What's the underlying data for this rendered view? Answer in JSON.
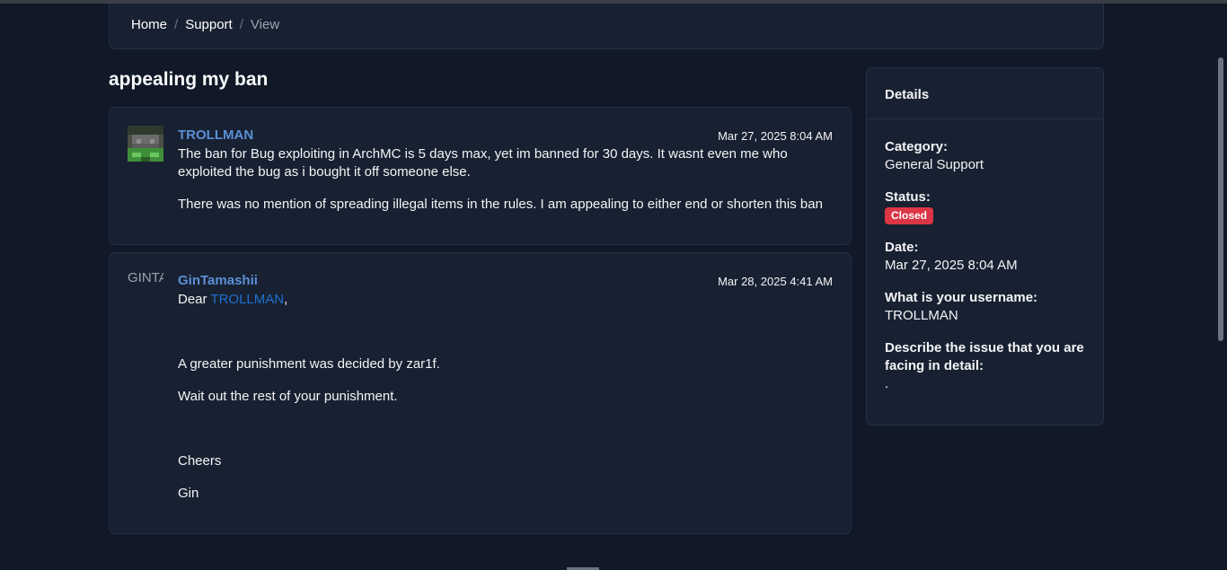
{
  "breadcrumb": {
    "items": [
      "Home",
      "Support"
    ],
    "separator": "/",
    "current": "View"
  },
  "page": {
    "title": "appealing my ban"
  },
  "posts": [
    {
      "author": "TROLLMAN",
      "date": "Mar 27, 2025 8:04 AM",
      "paragraphs": [
        "The ban for Bug exploiting in ArchMC is 5 days max, yet im banned for 30 days. It wasnt even me who exploited the bug as i bought it off someone else.",
        "There was no mention of spreading illegal items in the rules. I am appealing to either end or shorten this ban"
      ]
    },
    {
      "author": "GinTamashii",
      "avatar_alt": "GINTAMASHII",
      "date": "Mar 28, 2025 4:41 AM",
      "greeting_prefix": "Dear ",
      "greeting_mention": "TROLLMAN",
      "greeting_suffix": ",",
      "paragraphs": [
        "A greater punishment was decided by zar1f.",
        "Wait out the rest of your punishment.",
        "Cheers",
        "Gin"
      ]
    }
  ],
  "details": {
    "title": "Details",
    "category_label": "Category:",
    "category_value": "General Support",
    "status_label": "Status:",
    "status_value": "Closed",
    "date_label": "Date:",
    "date_value": "Mar 27, 2025 8:04 AM",
    "username_label": "What is your username:",
    "username_value": "TROLLMAN",
    "issue_label": "Describe the issue that you are facing in detail:",
    "issue_value": "."
  },
  "colors": {
    "background": "#111827",
    "card": "#182131",
    "author_link": "#5b8fd6",
    "status_closed": "#dc3545"
  }
}
